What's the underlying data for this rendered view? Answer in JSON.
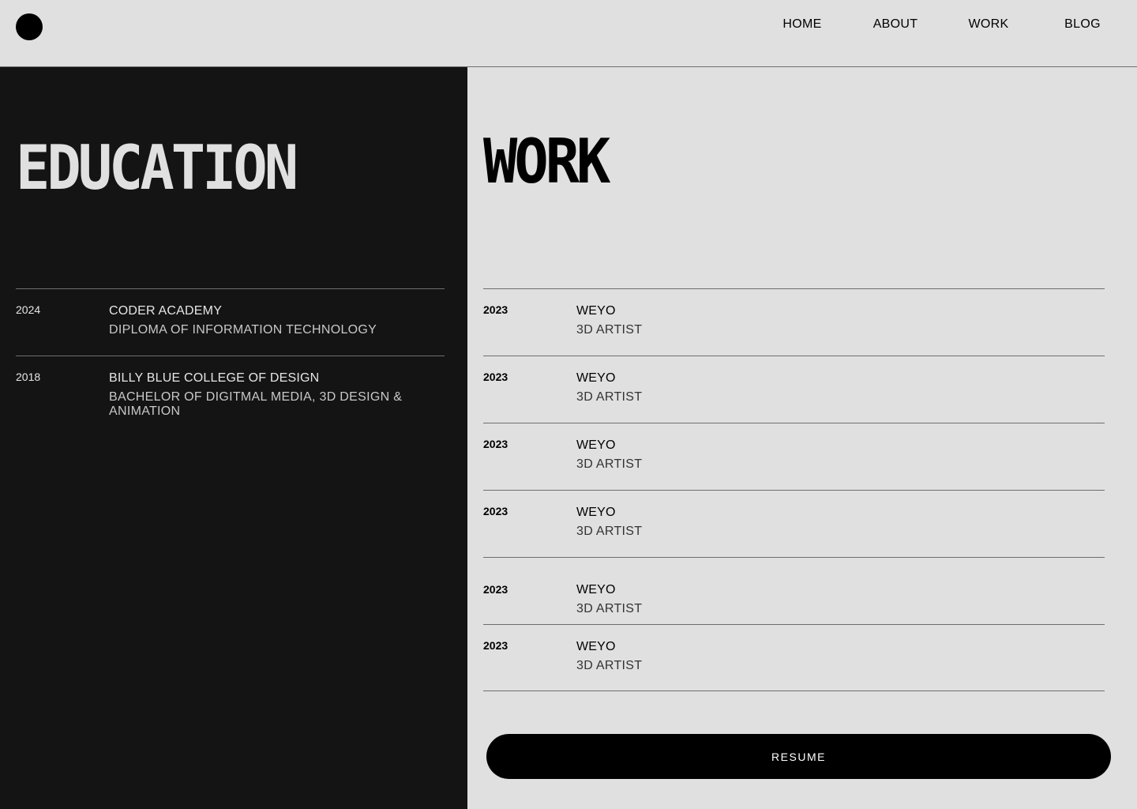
{
  "nav": {
    "items": [
      "HOME",
      "ABOUT",
      "WORK",
      "BLOG"
    ]
  },
  "education": {
    "title": "EDUCATION",
    "items": [
      {
        "year": "2024",
        "org": "CODER ACADEMY",
        "role": "DIPLOMA OF INFORMATION TECHNOLOGY"
      },
      {
        "year": "2018",
        "org": "BILLY BLUE COLLEGE OF DESIGN",
        "role": "BACHELOR OF DIGITMAL MEDIA, 3D DESIGN & ANIMATION"
      }
    ]
  },
  "work": {
    "title": "WORK",
    "items": [
      {
        "year": "2023",
        "org": "WEYO",
        "role": "3D ARTIST"
      },
      {
        "year": "2023",
        "org": "WEYO",
        "role": "3D ARTIST"
      },
      {
        "year": "2023",
        "org": "WEYO",
        "role": "3D ARTIST"
      },
      {
        "year": "2023",
        "org": "WEYO",
        "role": "3D ARTIST"
      },
      {
        "year": "2023",
        "org": "WEYO",
        "role": "3D ARTIST"
      },
      {
        "year": "2023",
        "org": "WEYO",
        "role": "3D ARTIST"
      }
    ]
  },
  "resume_label": "RESUME"
}
